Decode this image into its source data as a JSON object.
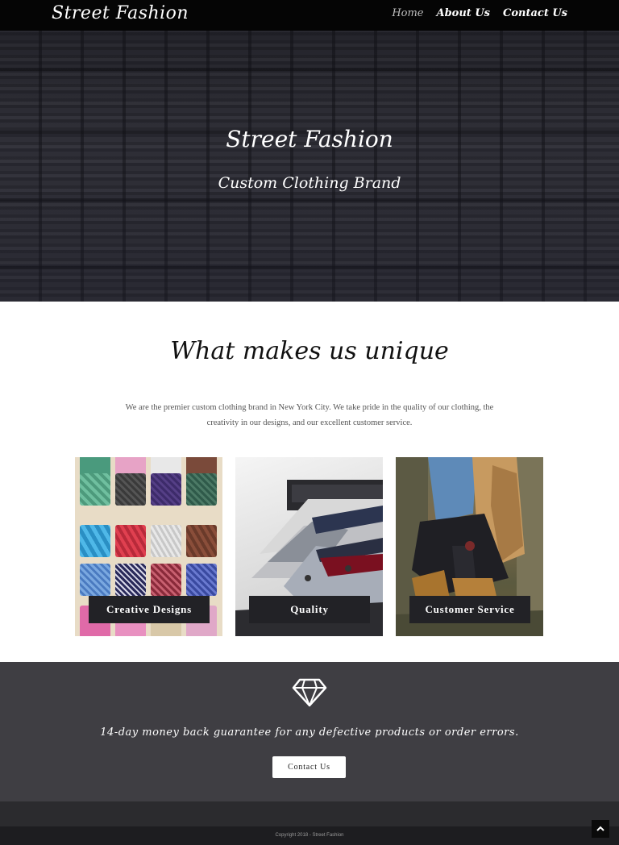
{
  "nav": {
    "brand": "Street Fashion",
    "links": [
      {
        "label": "Home"
      },
      {
        "label": "About Us"
      },
      {
        "label": "Contact Us"
      }
    ]
  },
  "hero": {
    "title": "Street Fashion",
    "subtitle": "Custom Clothing Brand"
  },
  "unique": {
    "heading": "What makes us unique",
    "text": "We are the premier custom clothing brand in New York City. We take pride in the quality of our clothing, the creativity in our designs, and our excellent customer service.",
    "cards": [
      {
        "label": "Creative Designs"
      },
      {
        "label": "Quality"
      },
      {
        "label": "Customer Service"
      }
    ]
  },
  "guarantee": {
    "icon": "diamond-icon",
    "text": "14-day money back guarantee for any defective products or order errors.",
    "button_label": "Contact Us"
  },
  "footer": {
    "copyright": "Copyright 2018 - Street Fashion",
    "back_to_top_icon": "chevron-up-icon"
  }
}
